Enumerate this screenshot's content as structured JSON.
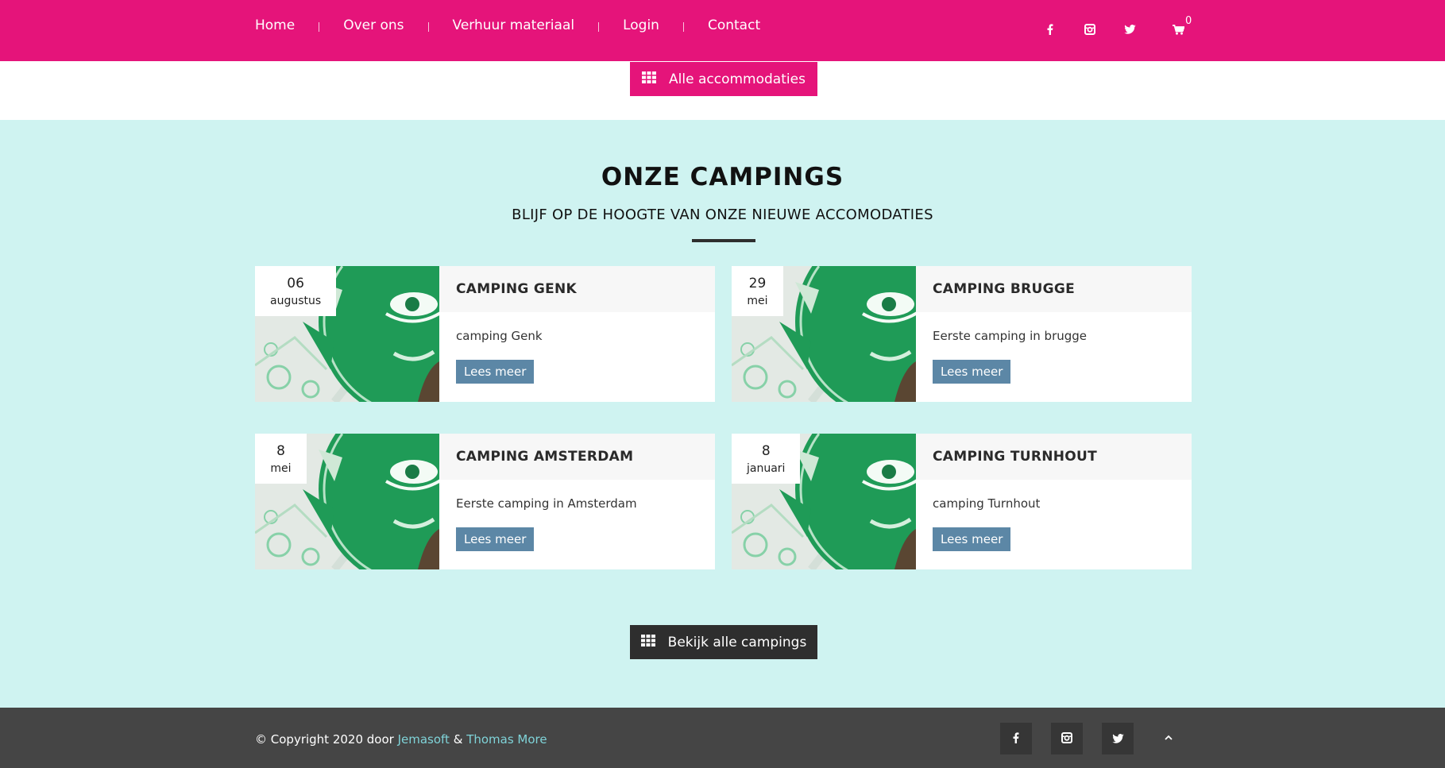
{
  "nav": {
    "links": [
      "Home",
      "Over ons",
      "Verhuur materiaal",
      "Login",
      "Contact"
    ],
    "cart_count": "0"
  },
  "buttons": {
    "all_accommodations": "Alle accommodaties",
    "all_campings": "Bekijk alle campings"
  },
  "section": {
    "title": "ONZE CAMPINGS",
    "subtitle": "BLIJF OP DE HOOGTE VAN ONZE NIEUWE ACCOMODATIES"
  },
  "campings": [
    {
      "day": "06",
      "month": "augustus",
      "title": "CAMPING GENK",
      "text": "camping Genk",
      "button": "Lees meer"
    },
    {
      "day": "29",
      "month": "mei",
      "title": "CAMPING BRUGGE",
      "text": "Eerste camping in brugge",
      "button": "Lees meer"
    },
    {
      "day": "8",
      "month": "mei",
      "title": "CAMPING AMSTERDAM",
      "text": "Eerste camping in Amsterdam",
      "button": "Lees meer"
    },
    {
      "day": "8",
      "month": "januari",
      "title": "CAMPING TURNHOUT",
      "text": "camping Turnhout",
      "button": "Lees meer"
    }
  ],
  "footer": {
    "copy_prefix": "© Copyright 2020 door ",
    "link1": "Jemasoft",
    "amp": " & ",
    "link2": "Thomas More"
  },
  "colors": {
    "brand_pink": "#e5147a",
    "section_bg": "#cff3f1",
    "button_blue": "#5c87a6",
    "footer_bg": "#454545",
    "footer_link": "#7fd3d8"
  },
  "icons": [
    "facebook-icon",
    "instagram-icon",
    "twitter-icon",
    "cart-icon",
    "grid-icon",
    "chevron-up-icon"
  ]
}
